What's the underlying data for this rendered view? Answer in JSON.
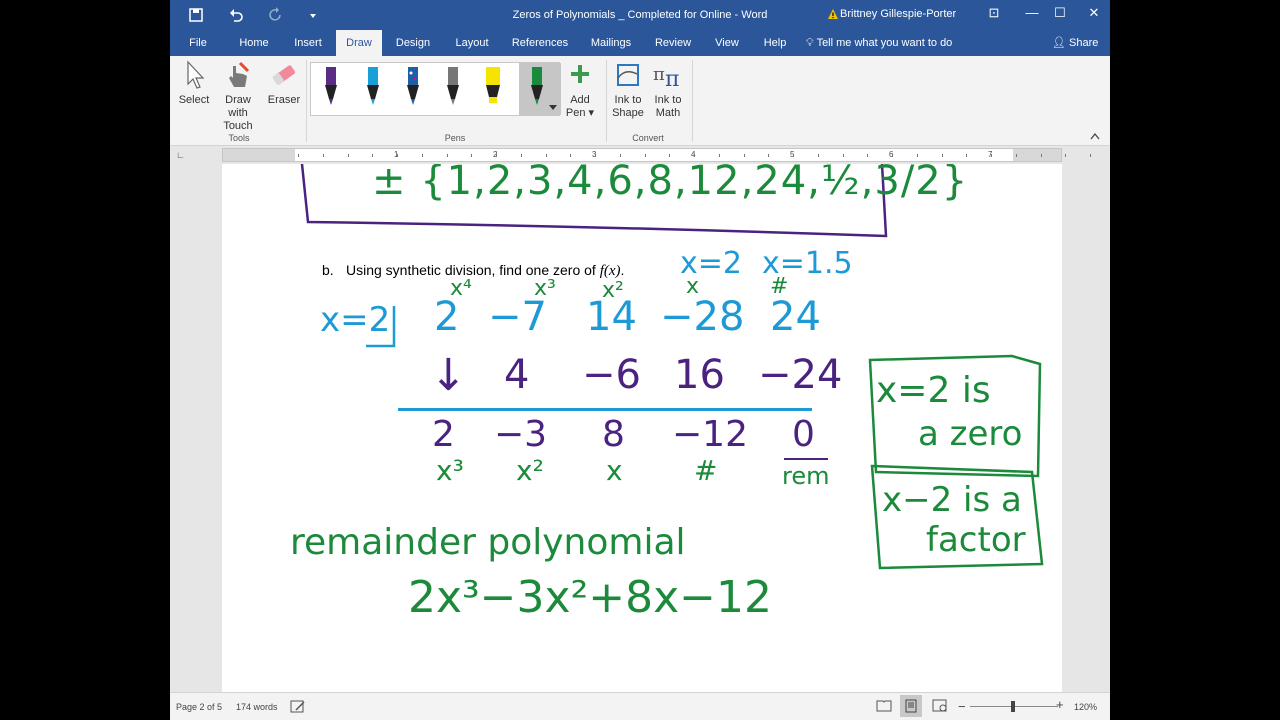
{
  "window": {
    "title": "Zeros of Polynomials _ Completed for Online  -  Word",
    "user": "Brittney Gillespie-Porter",
    "warning_icon": "warning-icon"
  },
  "tabs": {
    "items": [
      "File",
      "Home",
      "Insert",
      "Draw",
      "Design",
      "Layout",
      "References",
      "Mailings",
      "Review",
      "View",
      "Help"
    ],
    "active": "Draw",
    "tell_me": "Tell me what you want to do",
    "share": "Share"
  },
  "ribbon": {
    "tools": {
      "select": "Select",
      "draw_touch_1": "Draw with",
      "draw_touch_2": "Touch",
      "eraser": "Eraser",
      "group": "Tools"
    },
    "pens": {
      "group": "Pens",
      "colors": [
        "#5b2c83",
        "#1aa0d8",
        "#1e5fa8",
        "#777777",
        "#f5e400",
        "#1a8a3c"
      ]
    },
    "add_pen_1": "Add",
    "add_pen_2": "Pen",
    "convert": {
      "ink_shape_1": "Ink to",
      "ink_shape_2": "Shape",
      "ink_math_1": "Ink to",
      "ink_math_2": "Math",
      "group": "Convert"
    }
  },
  "ruler": {
    "numbers": [
      "1",
      "2",
      "3",
      "4",
      "5",
      "6",
      "7"
    ]
  },
  "document": {
    "question_label": "b.",
    "question_text": "Using synthetic division, find one zero of ",
    "question_fx": "f(x)",
    "question_end": ".",
    "ink": {
      "factor_list": "± {1,2,3,4,6,8,12,24,½,3/2}",
      "guess1": "x=2",
      "guess2": "x=1.5",
      "divisor": "x=2",
      "labels_top": [
        "x⁴",
        "x³",
        "x²",
        "x",
        "#"
      ],
      "row1": [
        "2",
        "−7",
        "14",
        "−28",
        "24"
      ],
      "down_arrow": "↓",
      "row2": [
        "4",
        "−6",
        "16",
        "−24"
      ],
      "row3": [
        "2",
        "−3",
        "8",
        "−12",
        "0"
      ],
      "labels_bottom": [
        "x³",
        "x²",
        "x",
        "#",
        "rem"
      ],
      "box1_line1": "x=2 is",
      "box1_line2": "a zero",
      "box2_line1": "x−2 is a",
      "box2_line2": "factor",
      "remainder_label": "remainder polynomial",
      "remainder_poly": "2x³−3x²+8x−12"
    }
  },
  "status": {
    "page": "Page 2 of 5",
    "words": "174 words",
    "zoom": "120%"
  },
  "colors": {
    "word_blue": "#2b579a",
    "ink_green": "#1b8a3a",
    "ink_blue": "#1d9ad6",
    "ink_purple": "#4a2280"
  }
}
